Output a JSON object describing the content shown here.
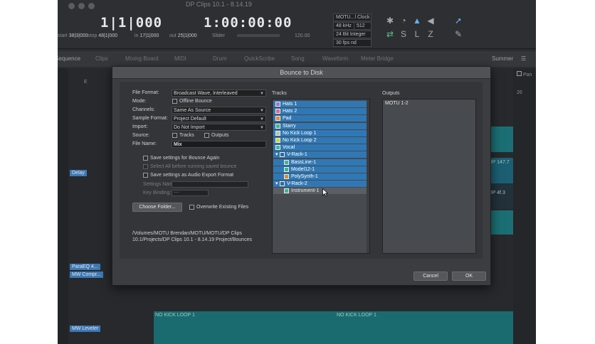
{
  "app_title": "DP Clips 10.1 - 8.14.19",
  "transport": {
    "counter_measures": "1|1|000",
    "counter_time": "1:00:00:00",
    "start_label": "start",
    "start_value": "38|3|000",
    "stop_label": "stop",
    "stop_value": "48|1|000",
    "in_label": "in",
    "in_value": "17|1|000",
    "out_label": "out",
    "out_value": "25|1|000",
    "tempo_label": "Slider",
    "tempo_value": "120.00",
    "clock_label": "MOTU...l Clock",
    "sample_rate": "48 kHz",
    "buffer": "512",
    "bit_depth": "24 Bit Integer",
    "frame_rate": "30 fps nd"
  },
  "tabs": [
    "Sequence",
    "Clips",
    "Mixing Board",
    "MIDI",
    "Drum",
    "QuickScribe",
    "Song",
    "Waveform",
    "Meter Bridge"
  ],
  "summer_label": "Summer",
  "pan_label": "Pan",
  "background": {
    "labels": [
      "Delay",
      "ParaEQ 4...",
      "MW Compr...",
      "MW Leveler"
    ],
    "clips": [
      "BP 147.7",
      "BP 4f.3",
      "NO KICK LOOP 1",
      "NO KICK LOOP 1"
    ],
    "marker": "E",
    "number": "26"
  },
  "dialog": {
    "title": "Bounce to Disk",
    "file_format_label": "File Format:",
    "file_format_value": "Broadcast Wave, Interleaved",
    "mode_label": "Mode:",
    "offline_bounce_label": "Offline Bounce",
    "channels_label": "Channels:",
    "channels_value": "Same As Source",
    "sample_format_label": "Sample Format:",
    "sample_format_value": "Project Default",
    "import_label": "Import:",
    "import_value": "Do Not Import",
    "source_label": "Source:",
    "source_tracks_label": "Tracks",
    "source_outputs_label": "Outputs",
    "file_name_label": "File Name:",
    "file_name_value": "Mix",
    "save_bounce_again_label": "Save settings for Bounce Again",
    "select_all_label": "Select All before running saved bounce",
    "save_audio_export_label": "Save settings as Audio Export Format",
    "settings_name_label": "Settings Name:",
    "key_binding_label": "Key Binding:",
    "key_binding_value": "----",
    "choose_folder_label": "Choose Folder...",
    "overwrite_label": "Overwrite Existing Files",
    "path": "/Volumes/MOTU Brendan/MOTU/MOTU/DP Clips 10.1/Projects/DP Clips 10.1 - 8.14.19 Project/Bounces",
    "tracks_title": "Tracks",
    "outputs_title": "Outputs",
    "tracks": [
      {
        "name": "Hats 1",
        "color": "#8f7bd6",
        "selected": true,
        "indent": 0
      },
      {
        "name": "Hats 2",
        "color": "#e06a8a",
        "selected": true,
        "indent": 0
      },
      {
        "name": "Pad",
        "color": "#e08a3a",
        "selected": true,
        "indent": 0
      },
      {
        "name": "Starry",
        "color": "#3fb59a",
        "selected": true,
        "indent": 0
      },
      {
        "name": "No Kick Loop 1",
        "color": "#bdbdbd",
        "selected": true,
        "indent": 0
      },
      {
        "name": "No Kick Loop 2",
        "color": "#c9d83a",
        "selected": true,
        "indent": 0
      },
      {
        "name": "Vocal",
        "color": "#3fb59a",
        "selected": true,
        "indent": 0
      },
      {
        "name": "V-Rack-1",
        "color": "#2b6aa2",
        "selected": true,
        "indent": 0
      },
      {
        "name": "BassLine-1",
        "color": "#3fb59a",
        "selected": true,
        "indent": 1
      },
      {
        "name": "Model12-1",
        "color": "#3fb59a",
        "selected": true,
        "indent": 1
      },
      {
        "name": "PolySynth-1",
        "color": "#e08a3a",
        "selected": true,
        "indent": 1
      },
      {
        "name": "V-Rack-2",
        "color": "#2b6aa2",
        "selected": true,
        "indent": 0
      },
      {
        "name": "Instrument-1",
        "color": "#3fb59a",
        "selected": false,
        "indent": 1
      }
    ],
    "outputs": [
      "MOTU 1-2"
    ],
    "cancel_label": "Cancel",
    "ok_label": "OK"
  }
}
